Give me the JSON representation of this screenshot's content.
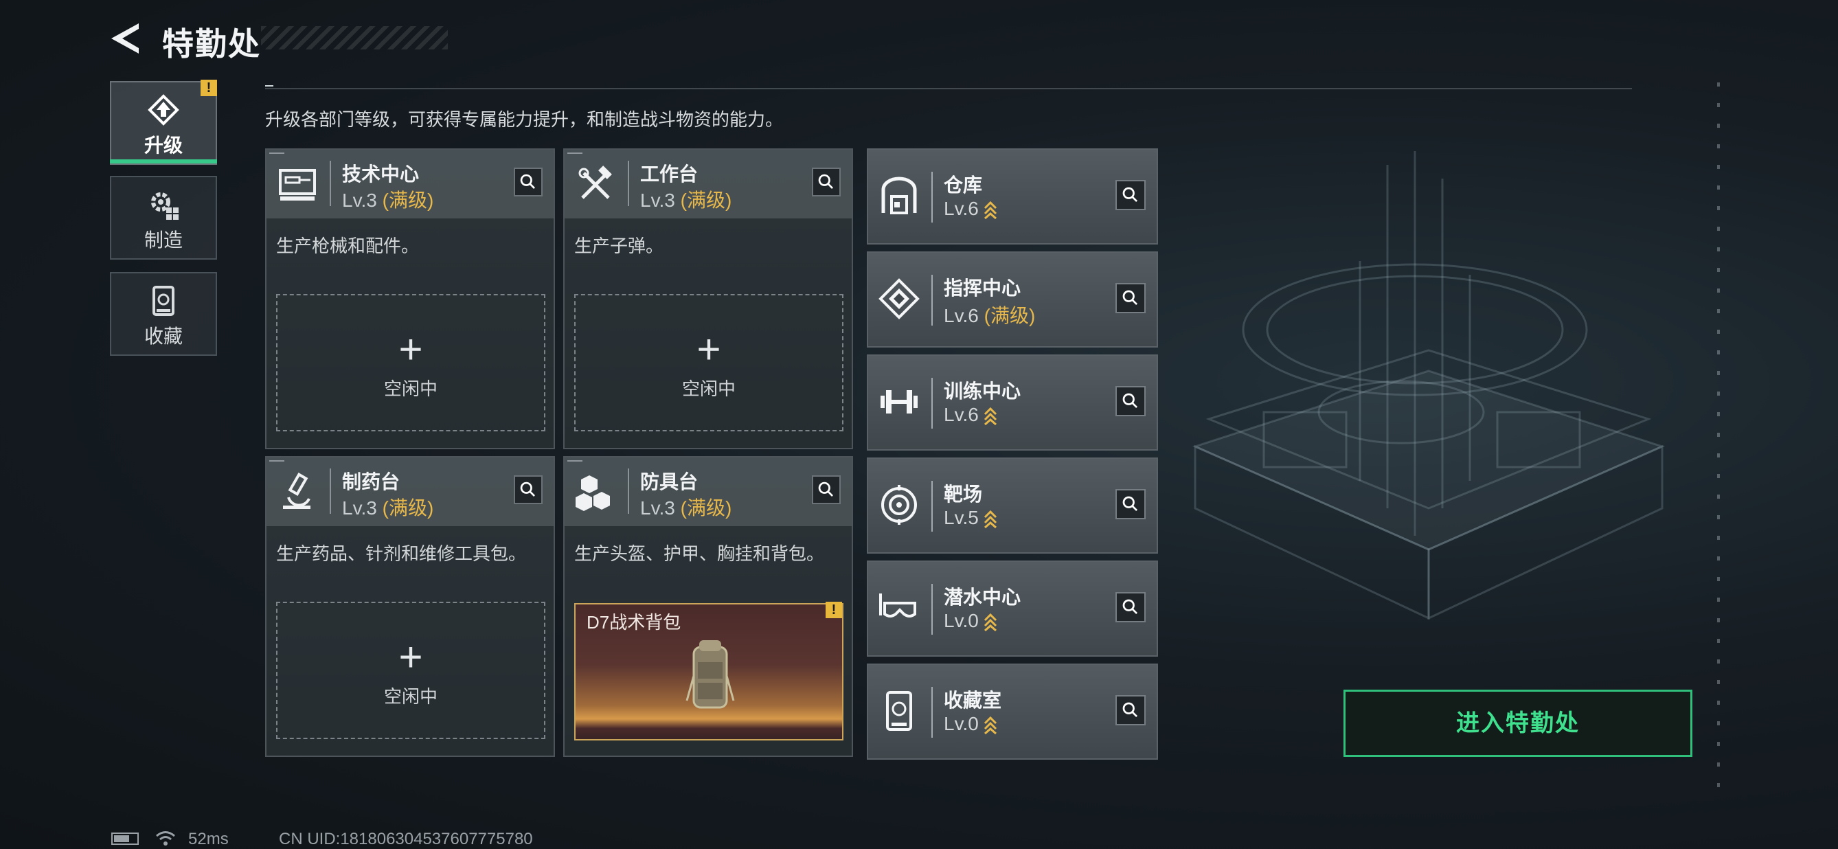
{
  "header": {
    "title": "特勤处"
  },
  "nav": {
    "items": [
      {
        "label": "升级",
        "icon": "upgrade-icon",
        "active": true,
        "alert": "!"
      },
      {
        "label": "制造",
        "icon": "gear-craft-icon",
        "active": false
      },
      {
        "label": "收藏",
        "icon": "collection-icon",
        "active": false
      }
    ]
  },
  "main": {
    "description": "升级各部门等级，可获得专属能力提升，和制造战斗物资的能力。",
    "departments": [
      {
        "name": "技术中心",
        "level": "Lv.3",
        "max": "(满级)",
        "desc": "生产枪械和配件。",
        "slot": {
          "plus": "+",
          "status": "空闲中"
        }
      },
      {
        "name": "工作台",
        "level": "Lv.3",
        "max": "(满级)",
        "desc": "生产子弹。",
        "slot": {
          "plus": "+",
          "status": "空闲中"
        }
      },
      {
        "name": "制药台",
        "level": "Lv.3",
        "max": "(满级)",
        "desc": "生产药品、针剂和维修工具包。",
        "slot": {
          "plus": "+",
          "status": "空闲中"
        }
      },
      {
        "name": "防具台",
        "level": "Lv.3",
        "max": "(满级)",
        "desc": "生产头盔、护甲、胸挂和背包。",
        "item": {
          "name": "D7战术背包",
          "alert": "!"
        }
      }
    ],
    "facilities": [
      {
        "name": "仓库",
        "level": "Lv.6",
        "upgradable": true
      },
      {
        "name": "指挥中心",
        "level": "Lv.6",
        "max": "(满级)"
      },
      {
        "name": "训练中心",
        "level": "Lv.6",
        "upgradable": true
      },
      {
        "name": "靶场",
        "level": "Lv.5",
        "upgradable": true
      },
      {
        "name": "潜水中心",
        "level": "Lv.0",
        "upgradable": true
      },
      {
        "name": "收藏室",
        "level": "Lv.0",
        "upgradable": true
      }
    ]
  },
  "enter_button": {
    "label": "进入特勤处"
  },
  "footer": {
    "ping": "52ms",
    "uid": "CN UID:181806304537607775780"
  },
  "colors": {
    "accent": "#37c98a",
    "max_level": "#e8b94a",
    "alert": "#e7b83c"
  }
}
